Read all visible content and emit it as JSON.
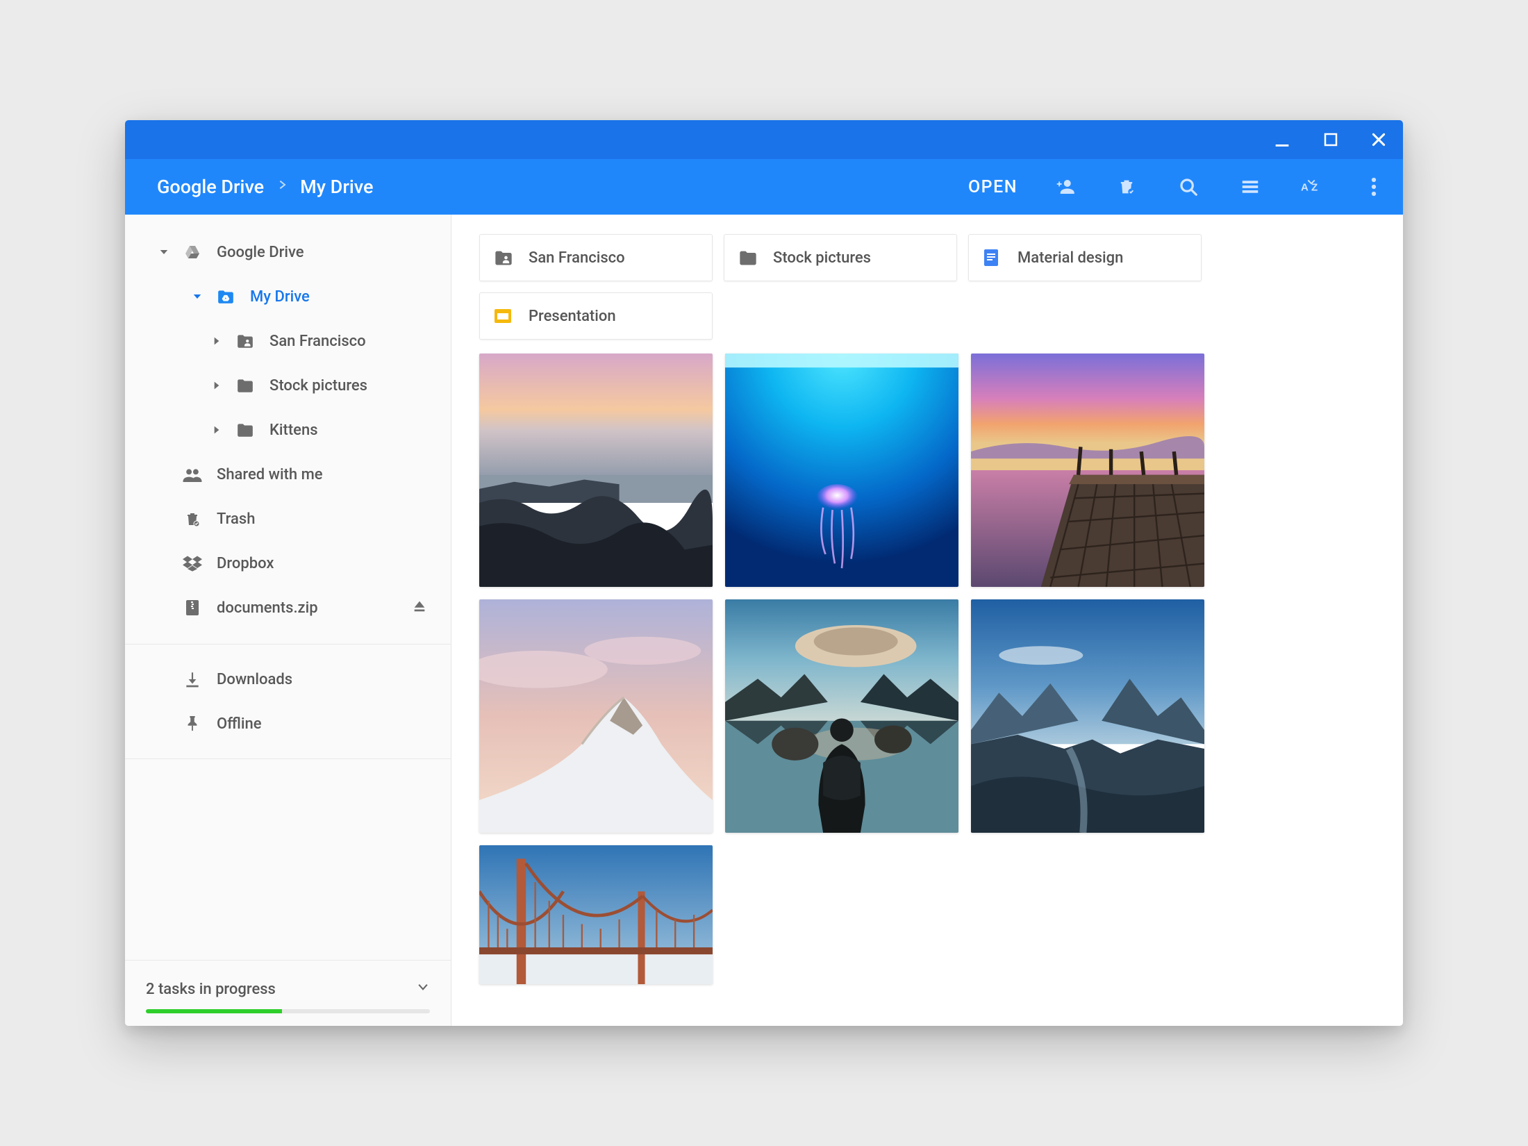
{
  "breadcrumb": {
    "root": "Google Drive",
    "current": "My Drive"
  },
  "actions": {
    "open": "OPEN"
  },
  "sidebar": {
    "root": "Google Drive",
    "mydrive": "My Drive",
    "folders": {
      "sf": "San Francisco",
      "stock": "Stock pictures",
      "kittens": "Kittens"
    },
    "shared": "Shared with me",
    "trash": "Trash",
    "dropbox": "Dropbox",
    "zip": "documents.zip",
    "downloads": "Downloads",
    "offline": "Offline"
  },
  "status": {
    "label": "2 tasks in progress",
    "percent": 48
  },
  "chips": [
    {
      "label": "San Francisco",
      "type": "folder-shared"
    },
    {
      "label": "Stock pictures",
      "type": "folder"
    },
    {
      "label": "Material design",
      "type": "docs"
    },
    {
      "label": "Presentation",
      "type": "slides"
    }
  ]
}
